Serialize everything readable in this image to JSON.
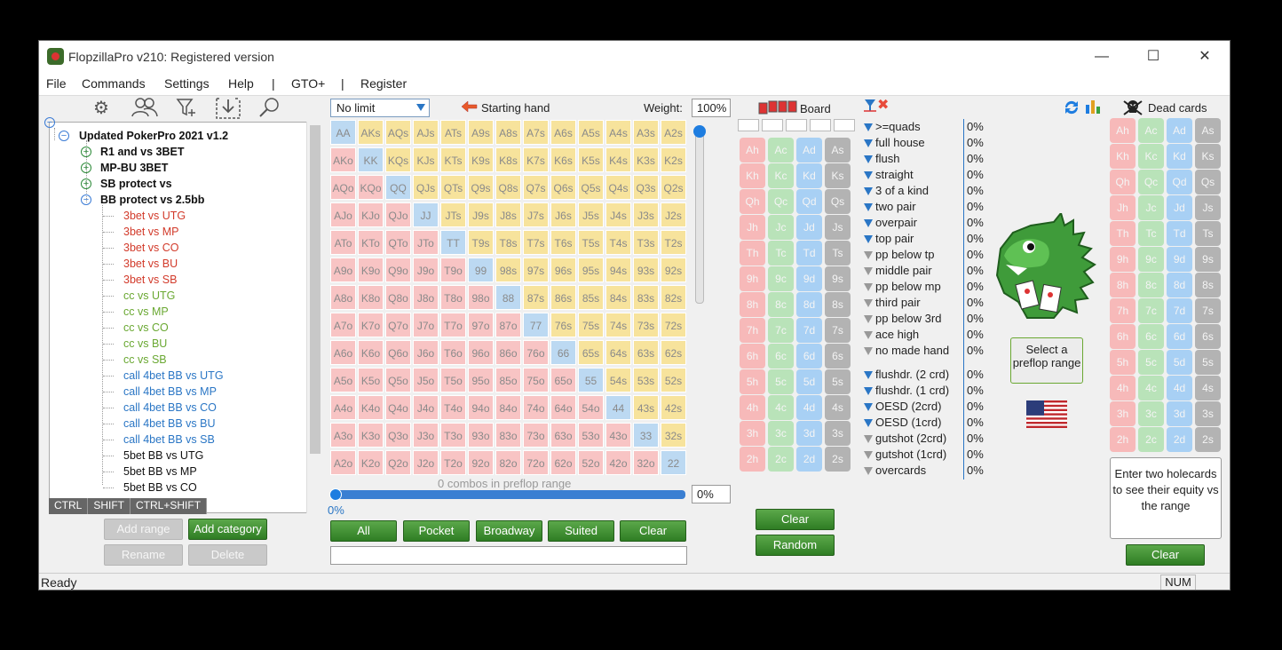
{
  "window": {
    "title": "FlopzillaPro v210: Registered version"
  },
  "menu": [
    "File",
    "Commands",
    "Settings",
    "Help",
    "|",
    "GTO+",
    "|",
    "Register"
  ],
  "tree": {
    "root": "Updated PokerPro 2021 v1.2",
    "groups": [
      {
        "label": "R1 and vs 3BET",
        "collapsed": true
      },
      {
        "label": "MP-BU 3BET",
        "collapsed": true
      },
      {
        "label": "SB protect vs",
        "collapsed": true
      },
      {
        "label": "BB protect vs 2.5bb",
        "collapsed": false
      }
    ],
    "items": [
      {
        "label": "3bet vs UTG",
        "color": "red"
      },
      {
        "label": "3bet vs MP",
        "color": "red"
      },
      {
        "label": "3bet vs CO",
        "color": "red"
      },
      {
        "label": "3bet vs BU",
        "color": "red"
      },
      {
        "label": "3bet vs SB",
        "color": "red"
      },
      {
        "label": "cc vs UTG",
        "color": "green"
      },
      {
        "label": "cc vs MP",
        "color": "green"
      },
      {
        "label": "cc vs CO",
        "color": "green"
      },
      {
        "label": "cc vs BU",
        "color": "green"
      },
      {
        "label": "cc vs SB",
        "color": "green"
      },
      {
        "label": "call 4bet BB vs UTG",
        "color": "blue"
      },
      {
        "label": "call 4bet BB vs MP",
        "color": "blue"
      },
      {
        "label": "call 4bet BB vs CO",
        "color": "blue"
      },
      {
        "label": "call 4bet BB vs BU",
        "color": "blue"
      },
      {
        "label": "call 4bet BB vs SB",
        "color": "blue"
      },
      {
        "label": "5bet BB vs UTG",
        "color": "black"
      },
      {
        "label": "5bet BB vs MP",
        "color": "black"
      },
      {
        "label": "5bet BB vs CO",
        "color": "black"
      }
    ],
    "modkeys": [
      "CTRL",
      "SHIFT",
      "CTRL+SHIFT"
    ],
    "buttons": {
      "add_range": "Add range",
      "add_category": "Add category",
      "rename": "Rename",
      "delete": "Delete"
    }
  },
  "range": {
    "game_type": "No limit",
    "starting_hand_label": "Starting hand",
    "weight_label": "Weight:",
    "weight_value": "100%",
    "ranks": [
      "A",
      "K",
      "Q",
      "J",
      "T",
      "9",
      "8",
      "7",
      "6",
      "5",
      "4",
      "3",
      "2"
    ],
    "combos_text": "0 combos in preflop range",
    "slider_pct": "0%",
    "slider_pct_right": "0%",
    "buttons": [
      "All",
      "Pocket",
      "Broadway",
      "Suited",
      "Clear"
    ],
    "bottom_input": ""
  },
  "board": {
    "title": "Board",
    "suits": [
      "h",
      "c",
      "d",
      "s"
    ],
    "clear": "Clear",
    "random": "Random"
  },
  "stats": {
    "made": [
      {
        "label": ">=quads",
        "pct": "0%",
        "active": true
      },
      {
        "label": "full house",
        "pct": "0%",
        "active": true
      },
      {
        "label": "flush",
        "pct": "0%",
        "active": true
      },
      {
        "label": "straight",
        "pct": "0%",
        "active": true
      },
      {
        "label": "3 of a kind",
        "pct": "0%",
        "active": true
      },
      {
        "label": "two pair",
        "pct": "0%",
        "active": true
      },
      {
        "label": "overpair",
        "pct": "0%",
        "active": true
      },
      {
        "label": "top pair",
        "pct": "0%",
        "active": true
      },
      {
        "label": "pp below tp",
        "pct": "0%",
        "active": false
      },
      {
        "label": "middle pair",
        "pct": "0%",
        "active": false
      },
      {
        "label": "pp below mp",
        "pct": "0%",
        "active": false
      },
      {
        "label": "third pair",
        "pct": "0%",
        "active": false
      },
      {
        "label": "pp below 3rd",
        "pct": "0%",
        "active": false
      },
      {
        "label": "ace high",
        "pct": "0%",
        "active": false
      },
      {
        "label": "no made hand",
        "pct": "0%",
        "active": false
      }
    ],
    "draws": [
      {
        "label": "flushdr. (2 crd)",
        "pct": "0%",
        "active": true
      },
      {
        "label": "flushdr. (1 crd)",
        "pct": "0%",
        "active": true
      },
      {
        "label": "OESD (2crd)",
        "pct": "0%",
        "active": true
      },
      {
        "label": "OESD (1crd)",
        "pct": "0%",
        "active": true
      },
      {
        "label": "gutshot (2crd)",
        "pct": "0%",
        "active": false
      },
      {
        "label": "gutshot (1crd)",
        "pct": "0%",
        "active": false
      },
      {
        "label": "overcards",
        "pct": "0%",
        "active": false
      }
    ]
  },
  "dead": {
    "title": "Dead cards",
    "select_range": "Select a preflop range",
    "info": "Enter two holecards to see their equity vs the range",
    "clear": "Clear"
  },
  "status": {
    "ready": "Ready",
    "num": "NUM"
  },
  "colors": {
    "accent": "#2a76c5",
    "button_green": "#3c8f2e",
    "pair": "#bcd9f2",
    "suited": "#f7e39c",
    "offsuit": "#f8c4c4"
  }
}
